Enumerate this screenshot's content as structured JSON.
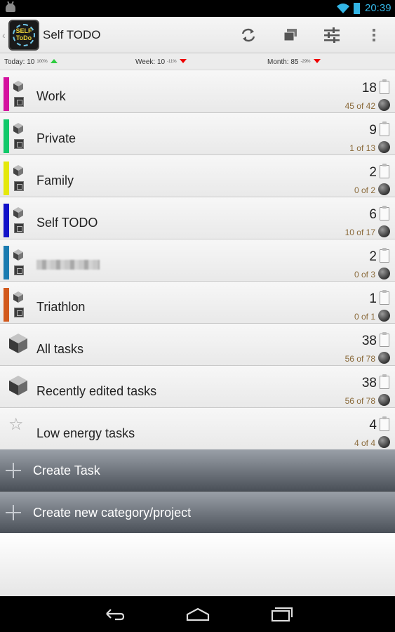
{
  "status_bar": {
    "time": "20:39",
    "icons": [
      "android-icon",
      "wifi-icon",
      "battery-icon"
    ],
    "accent_color": "#33b5e5"
  },
  "action_bar": {
    "logo_text_line1": "SELF",
    "logo_text_line2": "ToDo",
    "title": "Self TODO",
    "actions": [
      "sync-icon",
      "copy-icon",
      "filter-settings-icon",
      "overflow-menu-icon"
    ]
  },
  "stats": {
    "today": {
      "label": "Today: 10",
      "pct": "100%",
      "trend": "up"
    },
    "week": {
      "label": "Week: 10",
      "pct": "-11%",
      "trend": "down"
    },
    "month": {
      "label": "Month: 85",
      "pct": "-29%",
      "trend": "down"
    }
  },
  "categories": [
    {
      "name": "Work",
      "color": "#d4109e",
      "count": "18",
      "sub": "45 of 42",
      "icon": "cube-icon"
    },
    {
      "name": "Private",
      "color": "#11c96a",
      "count": "9",
      "sub": "1 of 13",
      "icon": "cube-icon"
    },
    {
      "name": "Family",
      "color": "#e4e80a",
      "count": "2",
      "sub": "0 of 2",
      "icon": "cube-icon"
    },
    {
      "name": "Self TODO",
      "color": "#1010c8",
      "count": "6",
      "sub": "10 of 17",
      "icon": "cube-icon"
    },
    {
      "name": "",
      "color": "#1a7bb0",
      "count": "2",
      "sub": "0 of 3",
      "icon": "cube-icon",
      "blurred": true
    },
    {
      "name": "Triathlon",
      "color": "#d2591c",
      "count": "1",
      "sub": "0 of 1",
      "icon": "cube-icon"
    }
  ],
  "special_lists": [
    {
      "name": "All tasks",
      "count": "38",
      "sub": "56 of 78",
      "icon": "cube-large-icon"
    },
    {
      "name": "Recently edited tasks",
      "count": "38",
      "sub": "56 of 78",
      "icon": "cube-large-icon"
    },
    {
      "name": "Low energy tasks",
      "count": "4",
      "sub": "4 of 4",
      "icon": "star-icon"
    }
  ],
  "actions": {
    "create_task": "Create Task",
    "create_category": "Create new category/project"
  },
  "nav_bar": [
    "back-icon",
    "home-icon",
    "recent-apps-icon"
  ]
}
